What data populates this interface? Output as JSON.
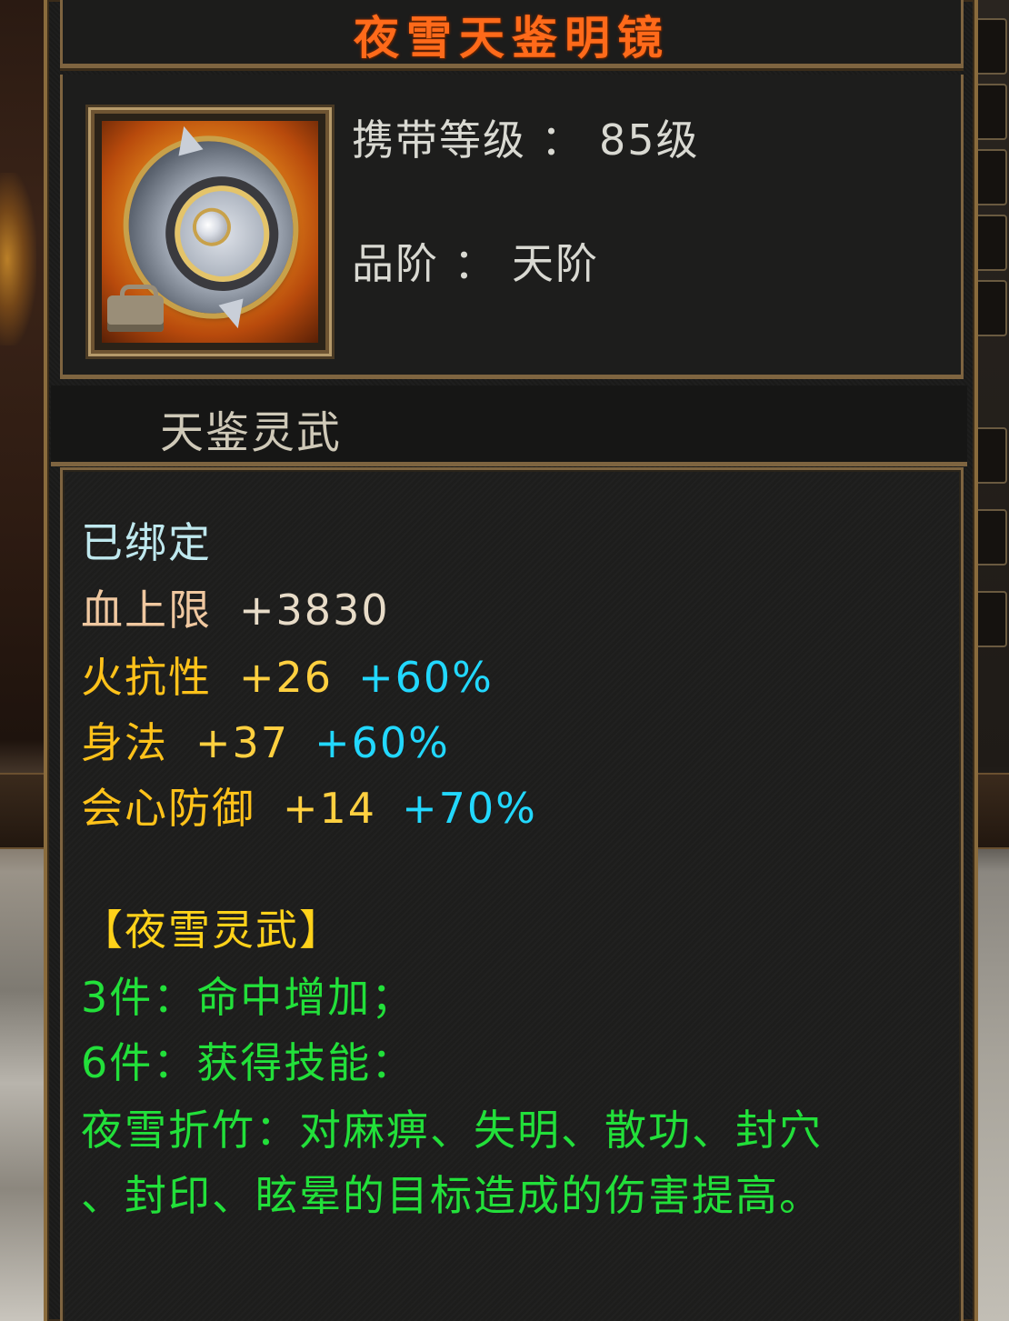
{
  "item": {
    "name": "夜雪天鉴明镜",
    "carry_level_label": "携带等级",
    "carry_level_value": "85级",
    "grade_label": "品阶",
    "grade_value": "天阶",
    "separator": "：",
    "category": "天鉴灵武",
    "bind_status": "已绑定",
    "stats": [
      {
        "name": "血上限",
        "base": "+3830",
        "pct": ""
      },
      {
        "name": "火抗性",
        "base": "+26",
        "pct": "+60%"
      },
      {
        "name": "身法",
        "base": "+37",
        "pct": "+60%"
      },
      {
        "name": "会心防御",
        "base": "+14",
        "pct": "+70%"
      }
    ],
    "set": {
      "title": "【夜雪灵武】",
      "lines": [
        "3件：命中增加；",
        "6件：获得技能：",
        "夜雪折竹：对麻痹、失明、散功、封穴",
        "、封印、眩晕的目标造成的伤害提高。"
      ]
    }
  },
  "colors": {
    "title": "#ff6a1a",
    "border": "#7e6440",
    "bound": "#bfe8ee",
    "stat_yellow": "#ffc21a",
    "stat_pct": "#22d8ff",
    "set_green": "#22e03a"
  },
  "icons": {
    "item_icon": "shield-mirror-icon",
    "bind_badge": "lock-badge-icon"
  }
}
